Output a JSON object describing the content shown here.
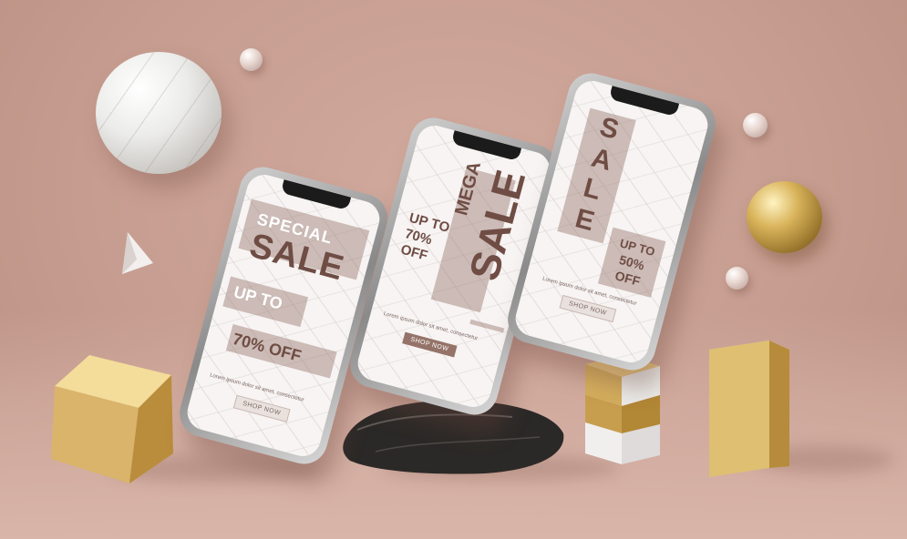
{
  "colors": {
    "background": "#c69d90",
    "accent_brown": "#6f4d44",
    "gold": "#d4af5f",
    "marble": "#f7f4f3"
  },
  "phones": [
    {
      "headline_top": "SPECIAL",
      "headline_main": "SALE",
      "line_1": "UP TO",
      "line_2": "70% OFF",
      "body_text": "Lorem ipsum dolor sit amet, consectetur",
      "button_label": "SHOP NOW"
    },
    {
      "headline_top": "MEGA",
      "headline_main": "SALE",
      "line_1": "UP TO",
      "line_2": "70%",
      "line_3": "OFF",
      "body_text": "Lorem ipsum dolor sit amet, consectetur",
      "button_label": "SHOP NOW"
    },
    {
      "headline_main": "SALE",
      "line_1": "UP TO",
      "line_2": "50%",
      "line_3": "OFF",
      "body_text": "Lorem ipsum dolor sit amet, consectetur",
      "button_label": "SHOP NOW"
    }
  ],
  "props": {
    "spheres": [
      "marble-sphere",
      "gold-sphere",
      "pearl",
      "pearl",
      "pearl"
    ],
    "shapes": [
      "gold-cube",
      "gold-box",
      "marble-gold-pedestal",
      "white-pyramid",
      "black-marble-rock"
    ]
  }
}
